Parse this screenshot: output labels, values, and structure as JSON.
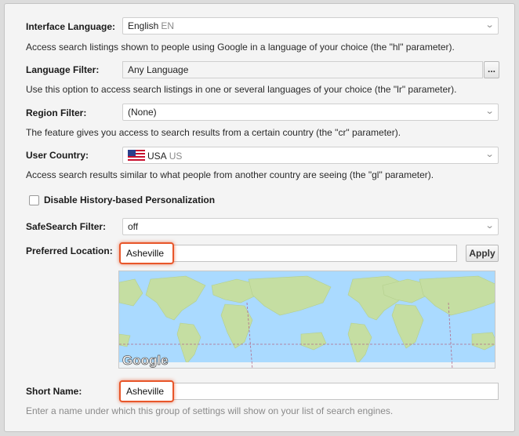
{
  "interface_language": {
    "label": "Interface Language:",
    "value": "English",
    "value_code": "EN",
    "description": "Access search listings shown to people using Google in a language of your choice (the \"hl\" parameter)."
  },
  "language_filter": {
    "label": "Language Filter:",
    "value": "Any Language",
    "button_label": "...",
    "description": "Use this option to access search listings in one or several languages of your choice (the \"lr\" parameter)."
  },
  "region_filter": {
    "label": "Region Filter:",
    "value": "(None)",
    "description": "The feature gives you access to search results from a certain country (the \"cr\" parameter)."
  },
  "user_country": {
    "label": "User Country:",
    "value": "USA",
    "value_code": "US",
    "description": "Access search results similar to what people from another country are seeing (the \"gl\" parameter)."
  },
  "history_personalization": {
    "label": "Disable History-based Personalization",
    "checked": false
  },
  "safesearch": {
    "label": "SafeSearch Filter:",
    "value": "off"
  },
  "preferred_location": {
    "label": "Preferred Location:",
    "value": "Asheville",
    "apply_label": "Apply"
  },
  "map": {
    "logo_text": "Google"
  },
  "short_name": {
    "label": "Short Name:",
    "value": "Asheville",
    "description": "Enter a name under which this group of settings will show on your list of search engines."
  },
  "colors": {
    "highlight": "#e8562a",
    "ocean": "#aadaff",
    "land": "#c5dea2",
    "border_dashed": "#b26a8a"
  }
}
